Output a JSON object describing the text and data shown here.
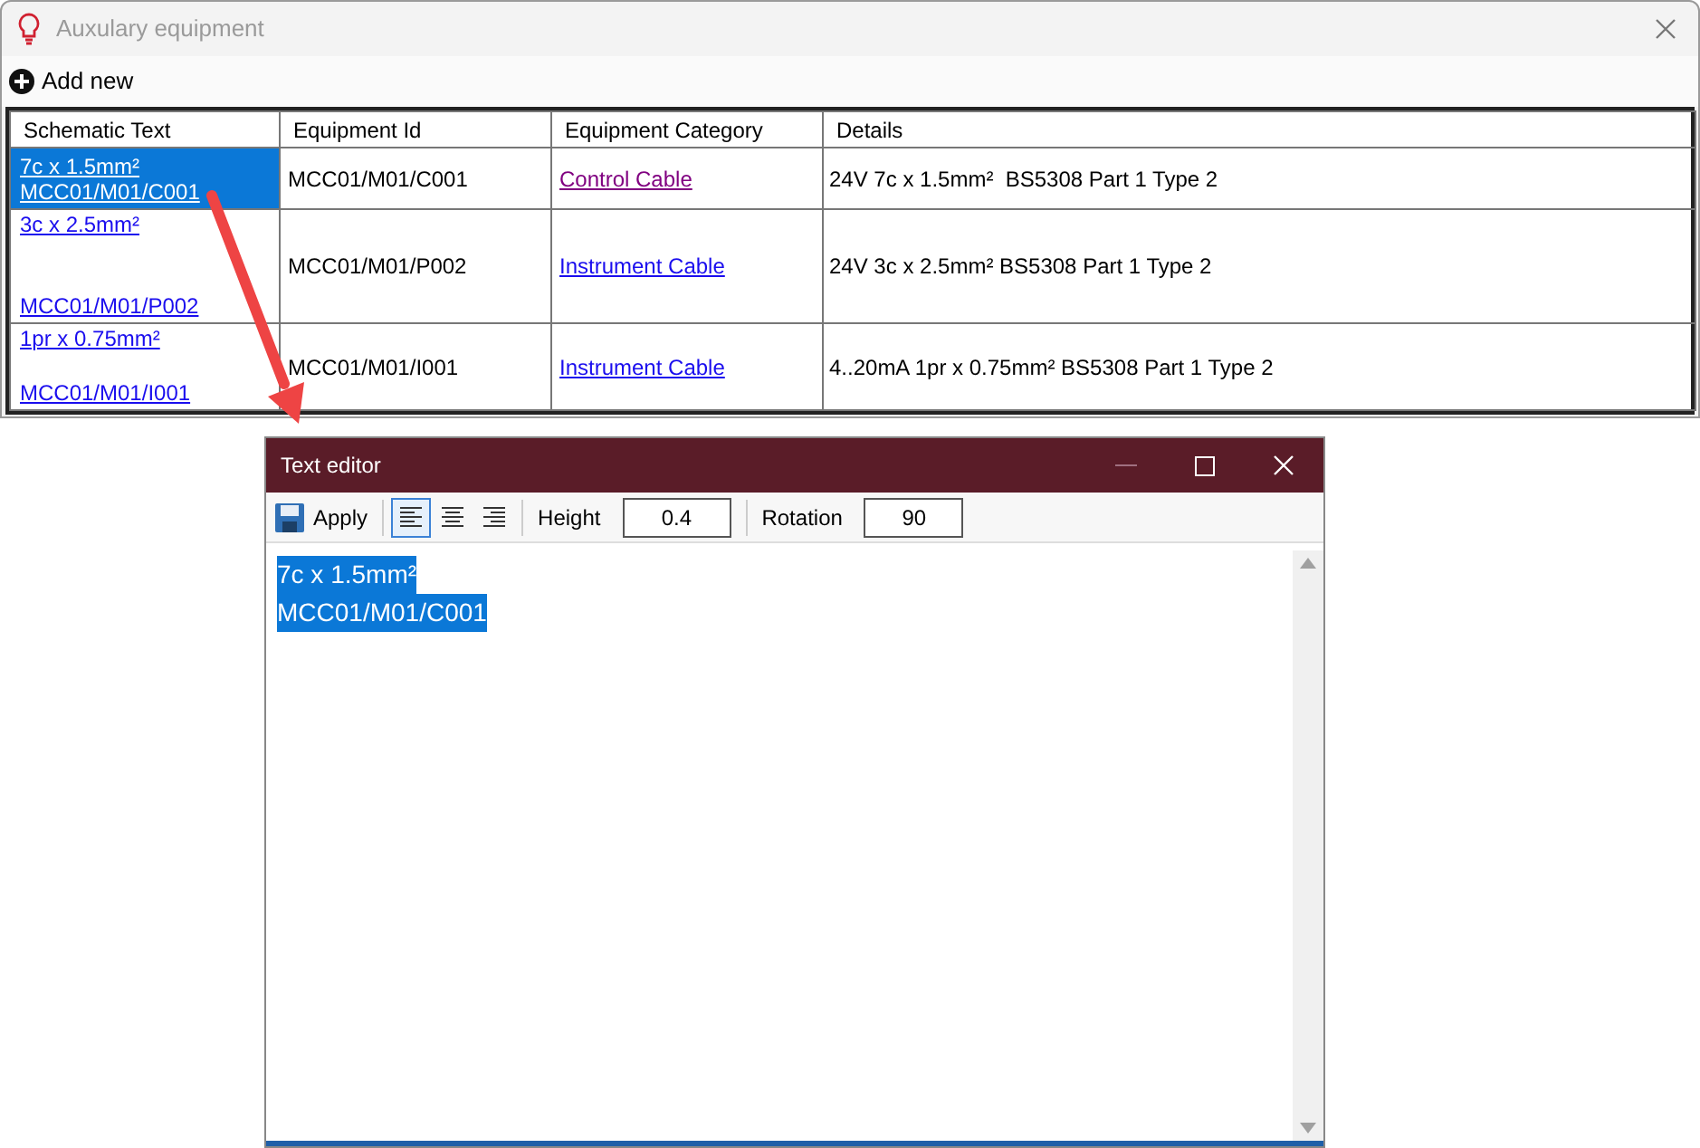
{
  "window": {
    "title": "Auxulary equipment"
  },
  "toolbar": {
    "add_label": "Add new"
  },
  "table": {
    "columns": [
      "Schematic Text",
      "Equipment Id",
      "Equipment Category",
      "Details"
    ],
    "rows": [
      {
        "selected": true,
        "schematic_text": [
          "7c x 1.5mm²",
          "MCC01/M01/C001"
        ],
        "equipment_id": "MCC01/M01/C001",
        "category": {
          "text": "Control Cable",
          "visited": true
        },
        "details": "24V 7c x 1.5mm²  BS5308 Part 1 Type 2"
      },
      {
        "selected": false,
        "schematic_text": [
          "3c x 2.5mm²",
          "MCC01/M01/P002"
        ],
        "equipment_id": "MCC01/M01/P002",
        "category": {
          "text": "Instrument Cable",
          "visited": false
        },
        "details": "24V 3c x 2.5mm² BS5308 Part 1 Type 2"
      },
      {
        "selected": false,
        "schematic_text": [
          "1pr x 0.75mm²",
          "MCC01/M01/I001"
        ],
        "equipment_id": "MCC01/M01/I001",
        "category": {
          "text": "Instrument Cable",
          "visited": false
        },
        "details": "4..20mA 1pr x 0.75mm² BS5308 Part 1 Type 2"
      }
    ]
  },
  "editor": {
    "title": "Text editor",
    "apply_label": "Apply",
    "alignments": [
      {
        "kind": "left",
        "selected": true
      },
      {
        "kind": "center",
        "selected": false
      },
      {
        "kind": "right",
        "selected": false
      }
    ],
    "height": {
      "label": "Height",
      "value": "0.4"
    },
    "rotation": {
      "label": "Rotation",
      "value": "90"
    },
    "lines": [
      "7c x 1.5mm²",
      "MCC01/M01/C001"
    ],
    "text_selected": true
  }
}
